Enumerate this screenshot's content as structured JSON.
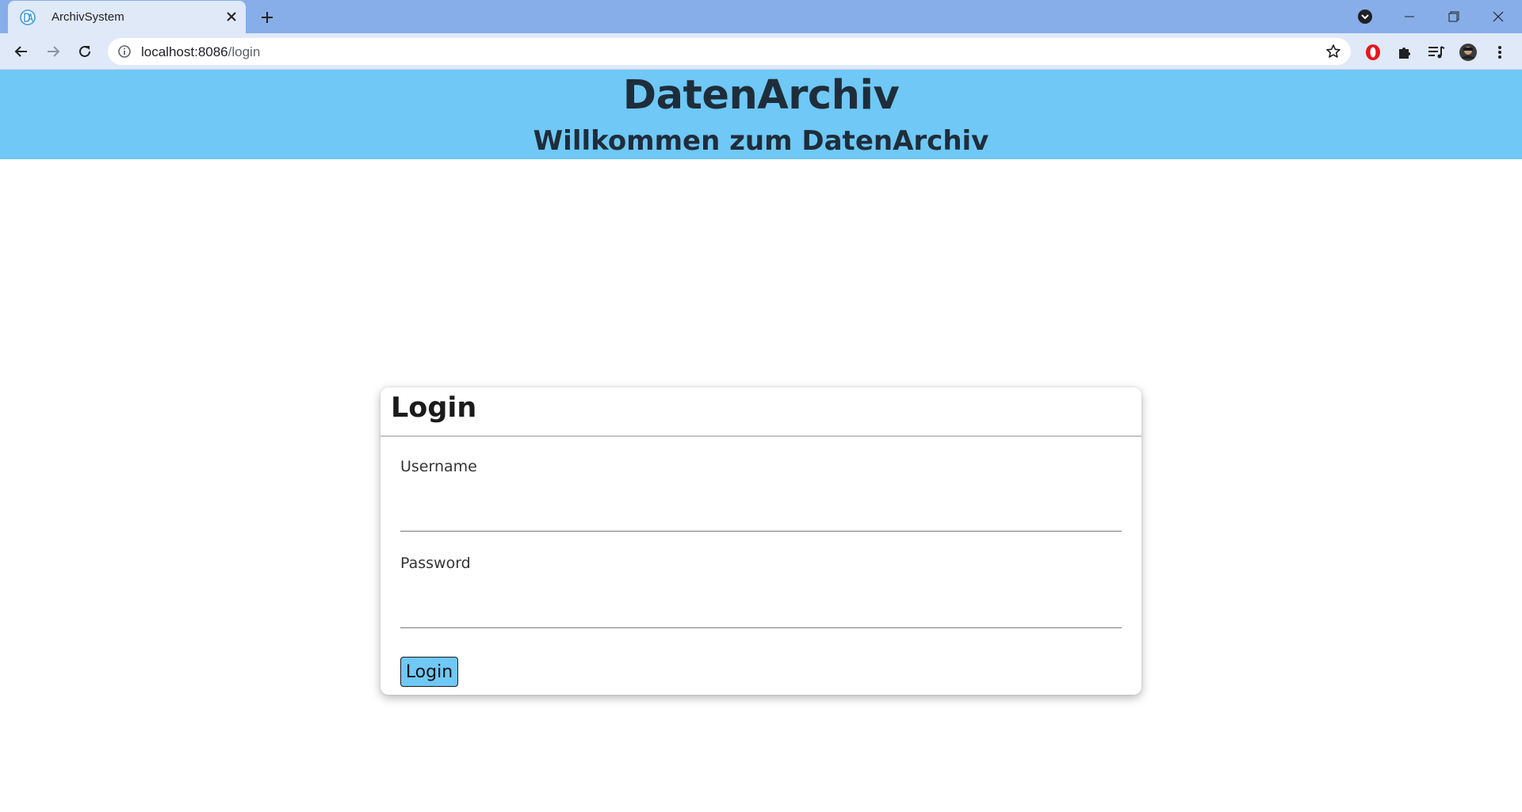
{
  "browser": {
    "tab": {
      "title": "ArchivSystem",
      "favicon_letters": "DA"
    },
    "url": {
      "host": "localhost:8086",
      "path": "/login"
    }
  },
  "header": {
    "title": "DatenArchiv",
    "subtitle": "Willkommen zum DatenArchiv"
  },
  "login": {
    "title": "Login",
    "username_label": "Username",
    "username_value": "",
    "password_label": "Password",
    "password_value": "",
    "button_label": "Login"
  },
  "colors": {
    "header_bg": "#6fc8f5",
    "button_bg": "#6fc8f5",
    "tabstrip_bg": "#87aee8",
    "toolbar_bg": "#dfe9f8"
  },
  "icons": {
    "tab_close": "close-icon",
    "new_tab": "plus-icon",
    "back": "arrow-left-icon",
    "forward": "arrow-right-icon",
    "reload": "reload-icon",
    "site_info": "info-icon",
    "bookmark": "star-icon",
    "extensions": "puzzle-icon",
    "menu": "kebab-menu-icon"
  }
}
